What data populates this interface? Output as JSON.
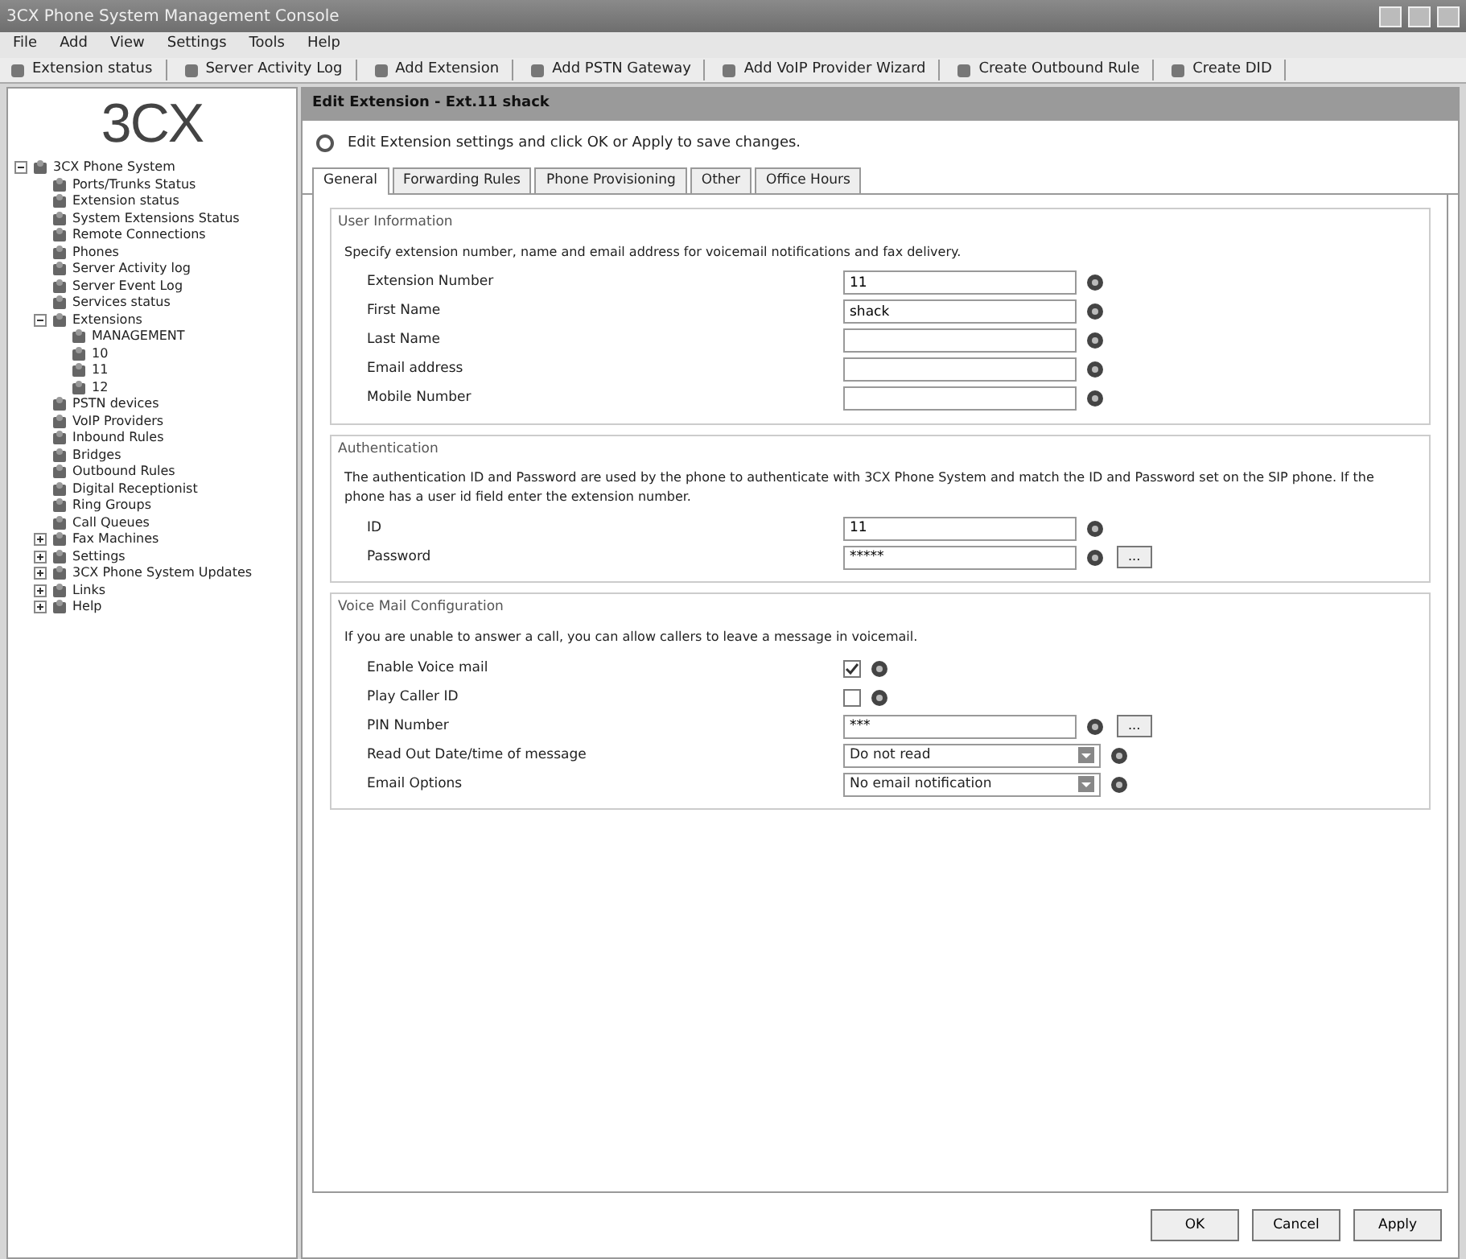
{
  "window": {
    "title": "3CX Phone System Management Console"
  },
  "menu": [
    "File",
    "Add",
    "View",
    "Settings",
    "Tools",
    "Help"
  ],
  "toolbar": [
    "Extension status",
    "Server Activity Log",
    "Add Extension",
    "Add PSTN Gateway",
    "Add VoIP Provider Wizard",
    "Create Outbound Rule",
    "Create DID"
  ],
  "logo": "3CX",
  "tree": [
    {
      "label": "3CX Phone System",
      "expanded": true,
      "children": [
        {
          "label": "Ports/Trunks Status"
        },
        {
          "label": "Extension status"
        },
        {
          "label": "System Extensions Status"
        },
        {
          "label": "Remote Connections"
        },
        {
          "label": "Phones"
        },
        {
          "label": "Server Activity log"
        },
        {
          "label": "Server Event Log"
        },
        {
          "label": "Services status"
        },
        {
          "label": "Extensions",
          "expanded": true,
          "children": [
            {
              "label": "MANAGEMENT"
            },
            {
              "label": "10"
            },
            {
              "label": "11"
            },
            {
              "label": "12"
            }
          ]
        },
        {
          "label": "PSTN devices"
        },
        {
          "label": "VoIP Providers"
        },
        {
          "label": "Inbound Rules"
        },
        {
          "label": "Bridges"
        },
        {
          "label": "Outbound Rules"
        },
        {
          "label": "Digital Receptionist"
        },
        {
          "label": "Ring Groups"
        },
        {
          "label": "Call Queues"
        },
        {
          "label": "Fax Machines",
          "expanded": false
        },
        {
          "label": "Settings",
          "expanded": false
        },
        {
          "label": "3CX Phone System Updates",
          "expanded": false
        },
        {
          "label": "Links",
          "expanded": false
        },
        {
          "label": "Help",
          "expanded": false
        }
      ]
    }
  ],
  "panel": {
    "title": "Edit Extension - Ext.11 shack",
    "hint": "Edit Extension settings and click OK or Apply to save changes."
  },
  "tabs": [
    {
      "label": "General",
      "selected": true
    },
    {
      "label": "Forwarding Rules",
      "selected": false
    },
    {
      "label": "Phone Provisioning",
      "selected": false
    },
    {
      "label": "Other",
      "selected": false
    },
    {
      "label": "Office Hours",
      "selected": false
    }
  ],
  "sections": [
    {
      "title": "User Information",
      "description": "Specify extension number, name and email address for voicemail notifications and fax delivery.",
      "fields": [
        {
          "kind": "text",
          "label": "Extension Number",
          "value": "11"
        },
        {
          "kind": "text",
          "label": "First Name",
          "value": "shack"
        },
        {
          "kind": "text",
          "label": "Last Name"
        },
        {
          "kind": "text",
          "label": "Email address"
        },
        {
          "kind": "text",
          "label": "Mobile Number"
        }
      ]
    },
    {
      "title": "Authentication",
      "description": "The authentication ID and Password are used by the phone to authenticate with 3CX Phone System and match the ID and Password set on the SIP phone. If the phone has a user id field enter the extension number.",
      "fields": [
        {
          "kind": "text",
          "label": "ID",
          "value": "11"
        },
        {
          "kind": "text",
          "label": "Password",
          "value": "*****",
          "button": "..."
        }
      ]
    },
    {
      "title": "Voice Mail Configuration",
      "description": "If you are unable to answer a call, you can allow callers to leave a message in voicemail.",
      "fields": [
        {
          "kind": "checkbox",
          "label": "Enable Voice mail",
          "checked": true
        },
        {
          "kind": "checkbox",
          "label": "Play Caller ID",
          "checked": false
        },
        {
          "kind": "text",
          "label": "PIN Number",
          "value": "***",
          "button": "..."
        },
        {
          "kind": "select",
          "label": "Read Out Date/time of message",
          "value": "Do not read"
        },
        {
          "kind": "select",
          "label": "Email Options",
          "value": "No email notification"
        }
      ]
    }
  ],
  "buttons": [
    "OK",
    "Cancel",
    "Apply"
  ]
}
